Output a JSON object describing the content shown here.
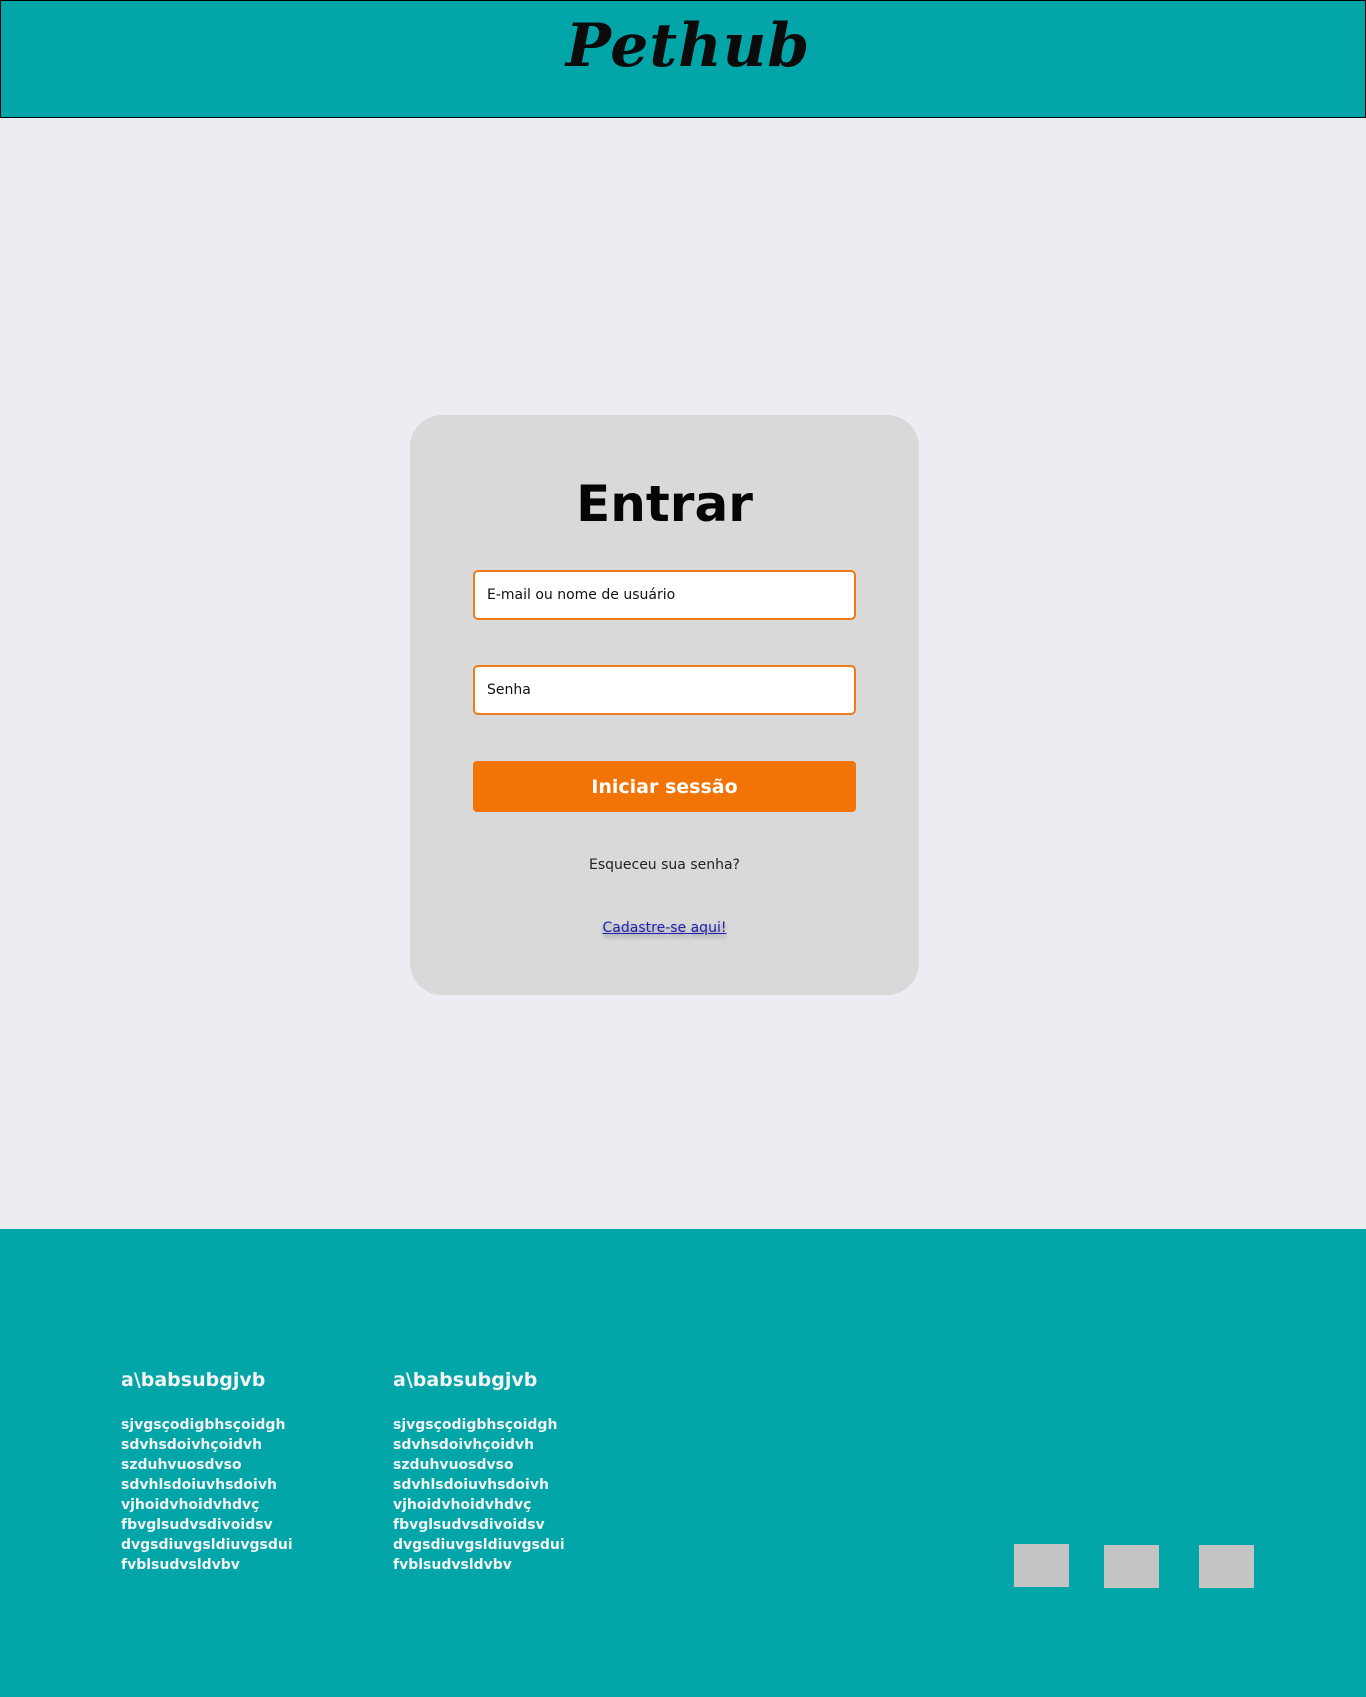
{
  "header": {
    "logo": "Pethub",
    "bg_color": "#03a6a8"
  },
  "login": {
    "title": "Entrar",
    "email_placeholder": "E-mail ou nome de usuário",
    "password_placeholder": "Senha",
    "submit_label": "Iniciar sessão",
    "forgot_label": "Esqueceu sua senha?",
    "signup_label": "Cadastre-se aqui!",
    "accent_color": "#f27406"
  },
  "footer": {
    "columns": [
      {
        "heading": "a\\babsubgjvb",
        "items": [
          "sjvgsçodigbhsçoidgh",
          "sdvhsdoivhçoidvh",
          "szduhvuosdvso",
          "sdvhlsdoiuvhsdoivh",
          "vjhoidvhoidvhdvç",
          "fbvglsudvsdivoidsv",
          "dvgsdiuvgsldiuvgsdui",
          "fvblsudvsldvbv"
        ]
      },
      {
        "heading": "a\\babsubgjvb",
        "items": [
          "sjvgsçodigbhsçoidgh",
          "sdvhsdoivhçoidvh",
          "szduhvuosdvso",
          "sdvhlsdoiuvhsdoivh",
          "vjhoidvhoidvhdvç",
          "fbvglsudvsdivoidsv",
          "dvgsdiuvgsldiuvgsdui",
          "fvblsudvsldvbv"
        ]
      }
    ],
    "social_icons": [
      "social-placeholder-icon",
      "social-placeholder-icon",
      "social-placeholder-icon"
    ]
  }
}
